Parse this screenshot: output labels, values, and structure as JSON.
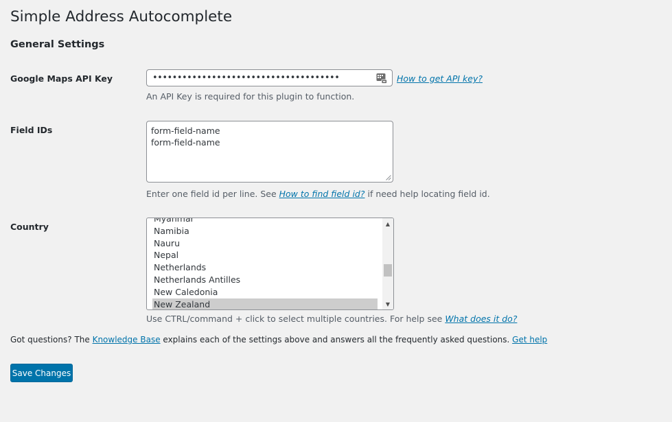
{
  "page": {
    "title": "Simple Address Autocomplete",
    "section_title": "General Settings"
  },
  "api_key": {
    "label": "Google Maps API Key",
    "masked_value": "••••••••••••••••••••••••••••••••••••••",
    "help_link": "How to get API key?",
    "description": "An API Key is required for this plugin to function."
  },
  "field_ids": {
    "label": "Field IDs",
    "lines": [
      "form-field-name",
      "form-field-name"
    ],
    "desc_before": "Enter one field id per line. See ",
    "desc_link": "How to find field id?",
    "desc_after": " if need help locating field id."
  },
  "country": {
    "label": "Country",
    "options": [
      "Myanmar",
      "Namibia",
      "Nauru",
      "Nepal",
      "Netherlands",
      "Netherlands Antilles",
      "New Caledonia",
      "New Zealand"
    ],
    "selected": "New Zealand",
    "desc_before": "Use CTRL/command + click to select multiple countries. For help see ",
    "desc_link": "What does it do?"
  },
  "help": {
    "text_before": "Got questions? The ",
    "kb_link": "Knowledge Base",
    "text_middle": " explains each of the settings above and answers all the frequently asked questions. ",
    "get_help_link": "Get help"
  },
  "actions": {
    "save_label": "Save Changes"
  },
  "colors": {
    "accent": "#0073aa",
    "background": "#f1f1f1",
    "selected_option": "#cdcdcd"
  },
  "icons": {
    "password_manager": "keypad-icon",
    "scroll_up": "triangle-up",
    "scroll_down": "triangle-down"
  }
}
